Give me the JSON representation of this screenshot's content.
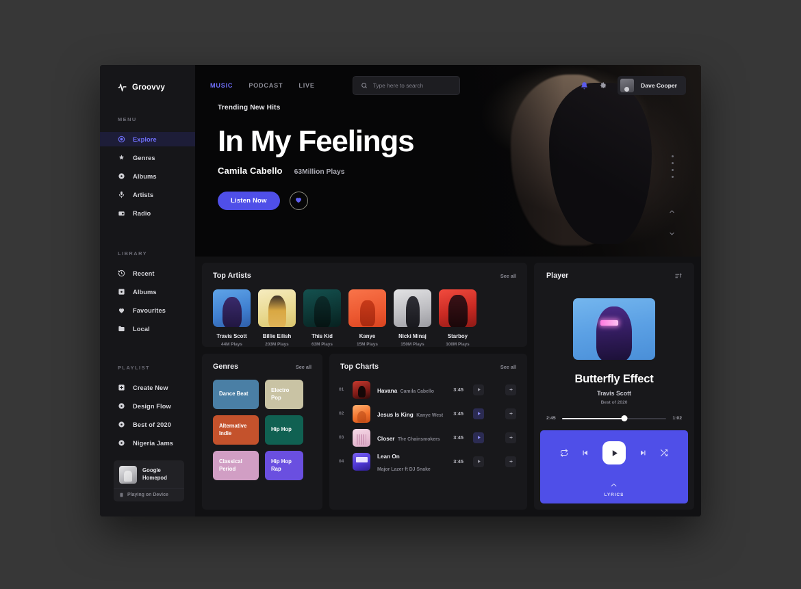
{
  "brand": {
    "name": "Groovvy",
    "icon": "waveform-icon"
  },
  "sidebar": {
    "menu_title": "MENU",
    "menu_items": [
      {
        "label": "Explore",
        "icon": "compass-icon",
        "active": true
      },
      {
        "label": "Genres",
        "icon": "tag-icon",
        "active": false
      },
      {
        "label": "Albums",
        "icon": "disc-icon",
        "active": false
      },
      {
        "label": "Artists",
        "icon": "mic-icon",
        "active": false
      },
      {
        "label": "Radio",
        "icon": "radio-icon",
        "active": false
      }
    ],
    "library_title": "LIBRARY",
    "library_items": [
      {
        "label": "Recent",
        "icon": "history-icon"
      },
      {
        "label": "Albums",
        "icon": "album-icon"
      },
      {
        "label": "Favourites",
        "icon": "heart-icon"
      },
      {
        "label": "Local",
        "icon": "folder-icon"
      }
    ],
    "playlist_title": "PLAYLIST",
    "playlist_items": [
      {
        "label": "Create New",
        "icon": "plus-square-icon"
      },
      {
        "label": "Design Flow",
        "icon": "disc-icon"
      },
      {
        "label": "Best of 2020",
        "icon": "disc-icon"
      },
      {
        "label": "Nigeria Jams",
        "icon": "disc-icon"
      }
    ],
    "device": {
      "name": "Google Homepod",
      "status": "Playing on Device",
      "status_icon": "speaker-icon"
    }
  },
  "header": {
    "tabs": [
      {
        "label": "MUSIC",
        "active": true
      },
      {
        "label": "PODCAST",
        "active": false
      },
      {
        "label": "LIVE",
        "active": false
      }
    ],
    "search": {
      "placeholder": "Type here to search",
      "value": "",
      "icon": "search-icon"
    },
    "bell_icon": "bell-icon",
    "gear_icon": "gear-icon",
    "user": {
      "name": "Dave Cooper",
      "avatar": "user-avatar"
    }
  },
  "hero": {
    "eyebrow": "Trending New Hits",
    "title": "In My Feelings",
    "artist": "Camila Cabello",
    "plays": "63Million Plays",
    "listen_label": "Listen Now",
    "heart_icon": "heart-icon",
    "dots": 4
  },
  "top_artists": {
    "title": "Top Artists",
    "see_all": "See all",
    "items": [
      {
        "name": "Travis Scott",
        "plays": "44M Plays"
      },
      {
        "name": "Billie Eilish",
        "plays": "203M Plays"
      },
      {
        "name": "This Kid",
        "plays": "63M Plays"
      },
      {
        "name": "Kanye",
        "plays": "15M Plays"
      },
      {
        "name": "Nicki Minaj",
        "plays": "150M Plays"
      },
      {
        "name": "Starboy",
        "plays": "100M Plays"
      }
    ]
  },
  "genres": {
    "title": "Genres",
    "see_all": "See all",
    "items": [
      {
        "label": "Dance Beat",
        "color": "#4a7fa5",
        "size": "lg"
      },
      {
        "label": "Electro Pop",
        "color": "#c9c3a4",
        "size": "sm"
      },
      {
        "label": "Alternative Indie",
        "color": "#c4522c",
        "size": "lg"
      },
      {
        "label": "Hip Hop",
        "color": "#106152",
        "size": "sm"
      },
      {
        "label": "Classical Period",
        "color": "#d19ec4",
        "size": "lg"
      },
      {
        "label": "Hip Hop Rap",
        "color": "#6a4fe0",
        "size": "sm"
      }
    ]
  },
  "top_charts": {
    "title": "Top Charts",
    "see_all": "See all",
    "tracks": [
      {
        "index": "01",
        "title": "Havana",
        "artist": "Camila Cabello",
        "time": "3:45",
        "play_icon": "play-icon",
        "add_icon": "add-icon"
      },
      {
        "index": "02",
        "title": "Jesus Is King",
        "artist": "Kanye West",
        "time": "3:45",
        "play_icon": "play-icon",
        "add_icon": "add-icon"
      },
      {
        "index": "03",
        "title": "Closer",
        "artist": "The Chainsmokers",
        "time": "3:45",
        "play_icon": "play-icon",
        "add_icon": "add-icon"
      },
      {
        "index": "04",
        "title": "Lean On",
        "artist": "Major Lazer ft DJ Snake",
        "time": "3:45",
        "play_icon": "play-icon",
        "add_icon": "add-icon"
      }
    ]
  },
  "player": {
    "title": "Player",
    "queue_icon": "queue-icon",
    "track_title": "Butterfly Effect",
    "track_artist": "Travis Scott",
    "track_album": "Best of 2020",
    "time_elapsed": "2:45",
    "time_total": "1:02",
    "progress_percent": 60,
    "controls": {
      "repeat_icon": "repeat-icon",
      "prev_icon": "previous-icon",
      "play_icon": "play-icon",
      "next_icon": "next-icon",
      "shuffle_icon": "shuffle-icon"
    },
    "lyrics_label": "LYRICS",
    "lyrics_chevron": "chevron-up-icon"
  },
  "colors": {
    "accent": "#4f4fe8",
    "accent_text": "#6f6ffa",
    "app_bg": "#111113",
    "card_bg": "#18181b",
    "sidebar_bg": "#161619"
  }
}
